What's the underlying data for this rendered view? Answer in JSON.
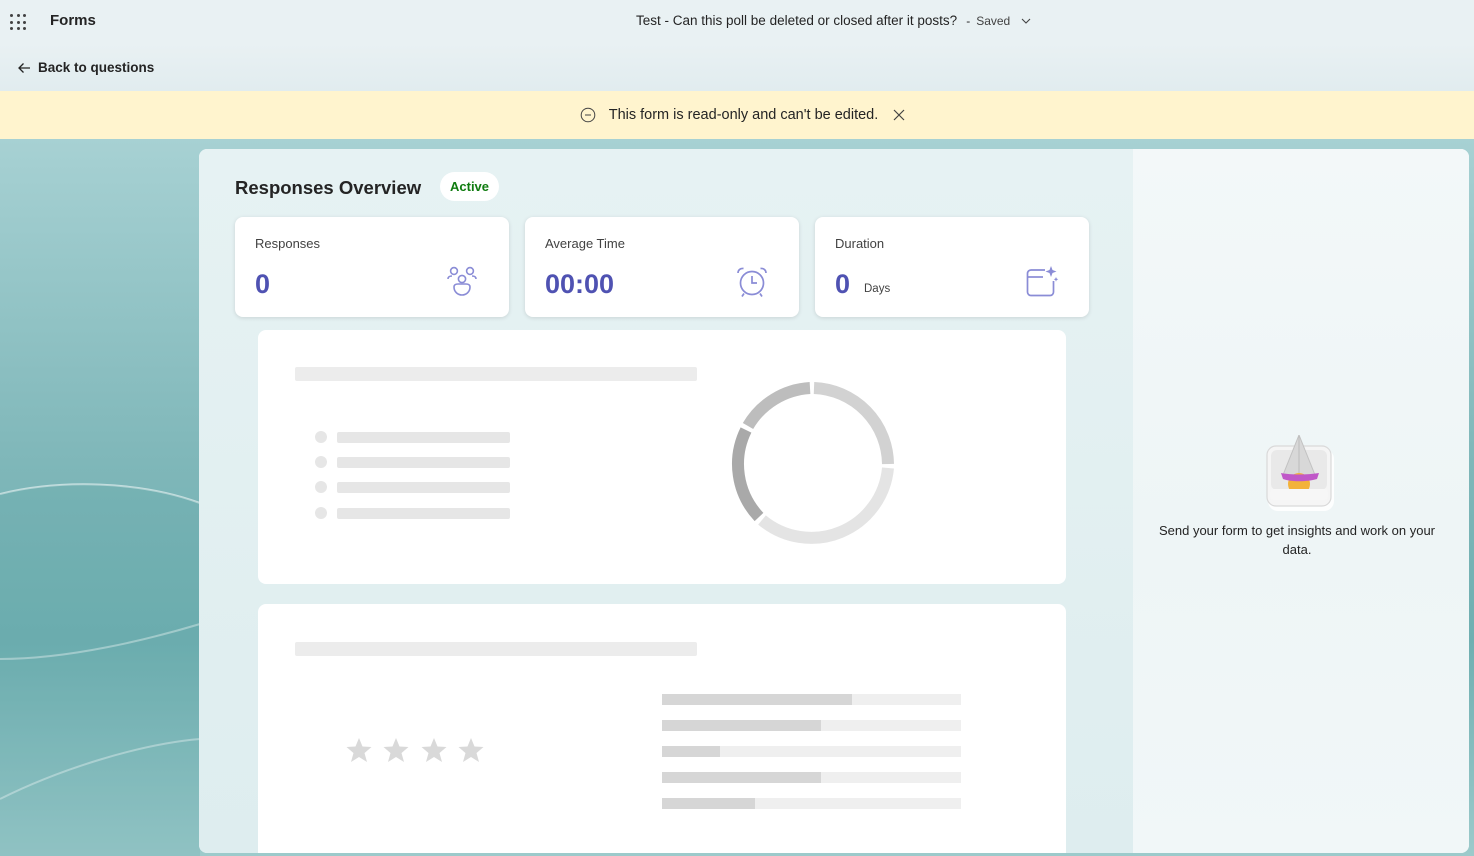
{
  "app": {
    "name": "Forms"
  },
  "header": {
    "form_title": "Test - Can this poll be deleted or closed after it posts?",
    "separator": "-",
    "save_status": "Saved"
  },
  "nav": {
    "back_label": "Back to questions"
  },
  "banner": {
    "message": "This form is read-only and can't be edited."
  },
  "overview": {
    "title": "Responses Overview",
    "status_badge": "Active",
    "stats": [
      {
        "label": "Responses",
        "value": "0",
        "icon": "people-icon"
      },
      {
        "label": "Average Time",
        "value": "00:00",
        "icon": "alarm-clock-icon"
      },
      {
        "label": "Duration",
        "value": "0",
        "unit": "Days",
        "icon": "calendar-sparkle-icon"
      }
    ]
  },
  "side_panel": {
    "empty_message": "Send your form to get insights and work on your data.",
    "icon": "paper-plane-inbox-icon"
  },
  "colors": {
    "accent": "#4f52b2",
    "badge_green": "#107c10",
    "banner_bg": "#fff4ce"
  }
}
